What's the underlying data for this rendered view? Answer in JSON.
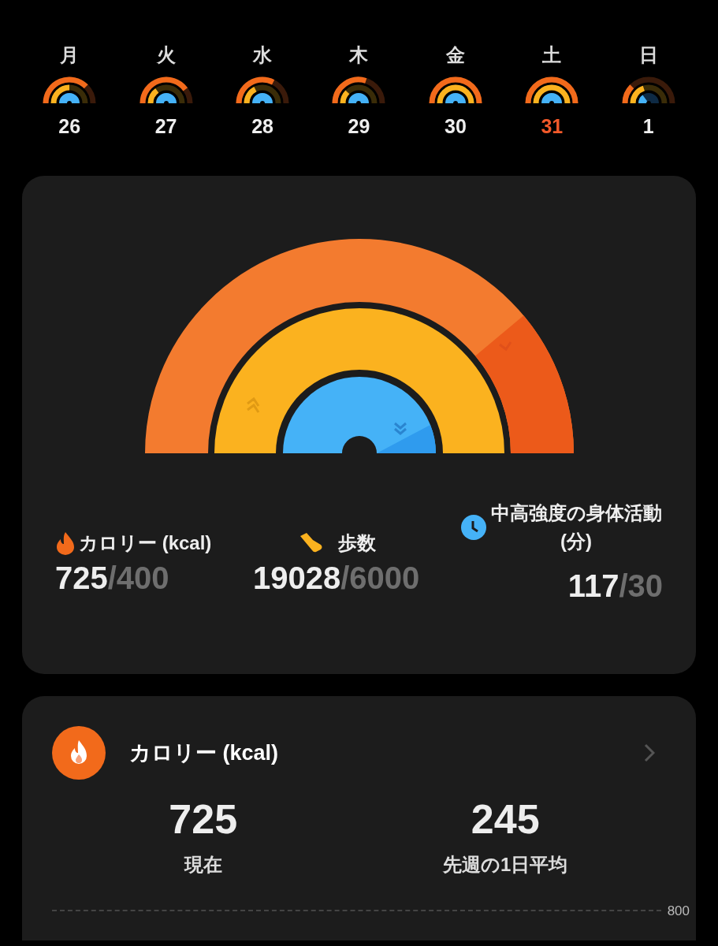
{
  "week": [
    {
      "weekday": "月",
      "date": "26",
      "selected": false
    },
    {
      "weekday": "火",
      "date": "27",
      "selected": false
    },
    {
      "weekday": "水",
      "date": "28",
      "selected": false
    },
    {
      "weekday": "木",
      "date": "29",
      "selected": false
    },
    {
      "weekday": "金",
      "date": "30",
      "selected": false
    },
    {
      "weekday": "土",
      "date": "31",
      "selected": true
    },
    {
      "weekday": "日",
      "date": "1",
      "selected": false
    }
  ],
  "summary": [
    {
      "kind": "calories",
      "label": "カロリー (kcal)",
      "value": "725",
      "goal": "/400"
    },
    {
      "kind": "steps",
      "label": "歩数",
      "value": "19028",
      "goal": "/6000"
    },
    {
      "kind": "active",
      "label": "中高強度の身体活動 (分)",
      "value": "117",
      "goal": "/30"
    }
  ],
  "calorie_card": {
    "title": "カロリー (kcal)",
    "stats": [
      {
        "value": "725",
        "label": "現在"
      },
      {
        "value": "245",
        "label": "先週の1日平均"
      }
    ],
    "chart_axis_label": "800"
  }
}
